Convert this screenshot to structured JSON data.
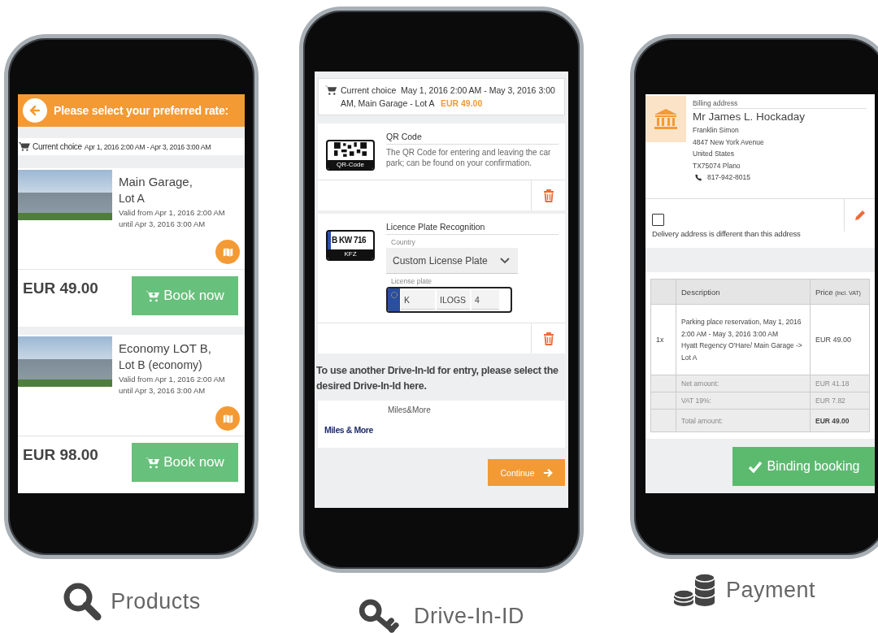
{
  "products": {
    "header": "Please select your preferred rate:",
    "current_choice_label": "Current choice",
    "current_choice_value": "Apr 1, 2016 2:00 AM - Apr 3, 2016 3:00 AM",
    "offers": [
      {
        "title": "Main Garage,",
        "subtitle": "Lot A",
        "valid_from": "Valid from Apr 1, 2016 2:00 AM",
        "valid_until": "until Apr 3, 2016 3:00 AM",
        "price": "EUR 49.00",
        "button": "Book now"
      },
      {
        "title": "Economy LOT B,",
        "subtitle": "Lot B (economy)",
        "valid_from": "Valid from Apr 1, 2016 2:00 AM",
        "valid_until": "until Apr 3, 2016 3:00 AM",
        "price": "EUR 98.00",
        "button": "Book now"
      }
    ],
    "caption": "Products"
  },
  "drive_in": {
    "current_choice_label": "Current choice",
    "current_choice_value": "May 1, 2016 2:00 AM - May 3, 2016 3:00 AM, Main Garage - Lot A",
    "current_choice_price": "EUR 49.00",
    "methods": [
      {
        "kind": "qr",
        "title": "QR Code",
        "image_text": "QR-Code",
        "description": "The QR Code for entering and leaving the car park; can be found on your confirmation."
      },
      {
        "kind": "plate",
        "title": "Licence Plate Recognition",
        "image_plate": "B KW 716",
        "image_label": "KFZ",
        "country_label": "Country",
        "country_value": "Custom License Plate",
        "plate_label": "License plate",
        "plate_parts": [
          "K",
          "ILOGS",
          "4"
        ]
      }
    ],
    "other_text": "To use another Drive-In-Id for entry, please select the desired Drive-In-Id here.",
    "partners": [
      {
        "logo": "Miles & More",
        "name": "Miles&More"
      }
    ],
    "continue_button": "Continue",
    "caption": "Drive-In-ID"
  },
  "payment": {
    "billing_label": "Billing address",
    "name": "Mr James L. Hockaday",
    "address_lines": [
      "Franklin Simon",
      "4847 New York Avenue",
      "United States",
      "TX75074 Plano"
    ],
    "phone": "817-942-8015",
    "delivery": {
      "label": "Delivery address is different than this address",
      "checked": false
    },
    "table": {
      "columns": [
        "Description",
        "Price"
      ],
      "price_note": "(incl. VAT)",
      "item": {
        "qty": "1x",
        "description_lines": [
          "Parking place reservation, May 1, 2016 2:00 AM - May 3, 2016 3:00 AM",
          "Hyatt Regency O'Hare/ Main Garage -> Lot A"
        ],
        "price": "EUR 49.00"
      },
      "summary": [
        {
          "label": "Net amount:",
          "value": "EUR 41.18",
          "kind": "plain"
        },
        {
          "label": "VAT 19%:",
          "value": "EUR 7.82",
          "kind": "plain"
        },
        {
          "label": "Total amount:",
          "value": "EUR 49.00",
          "kind": "total"
        }
      ]
    },
    "button": "Binding booking",
    "caption": "Payment"
  }
}
